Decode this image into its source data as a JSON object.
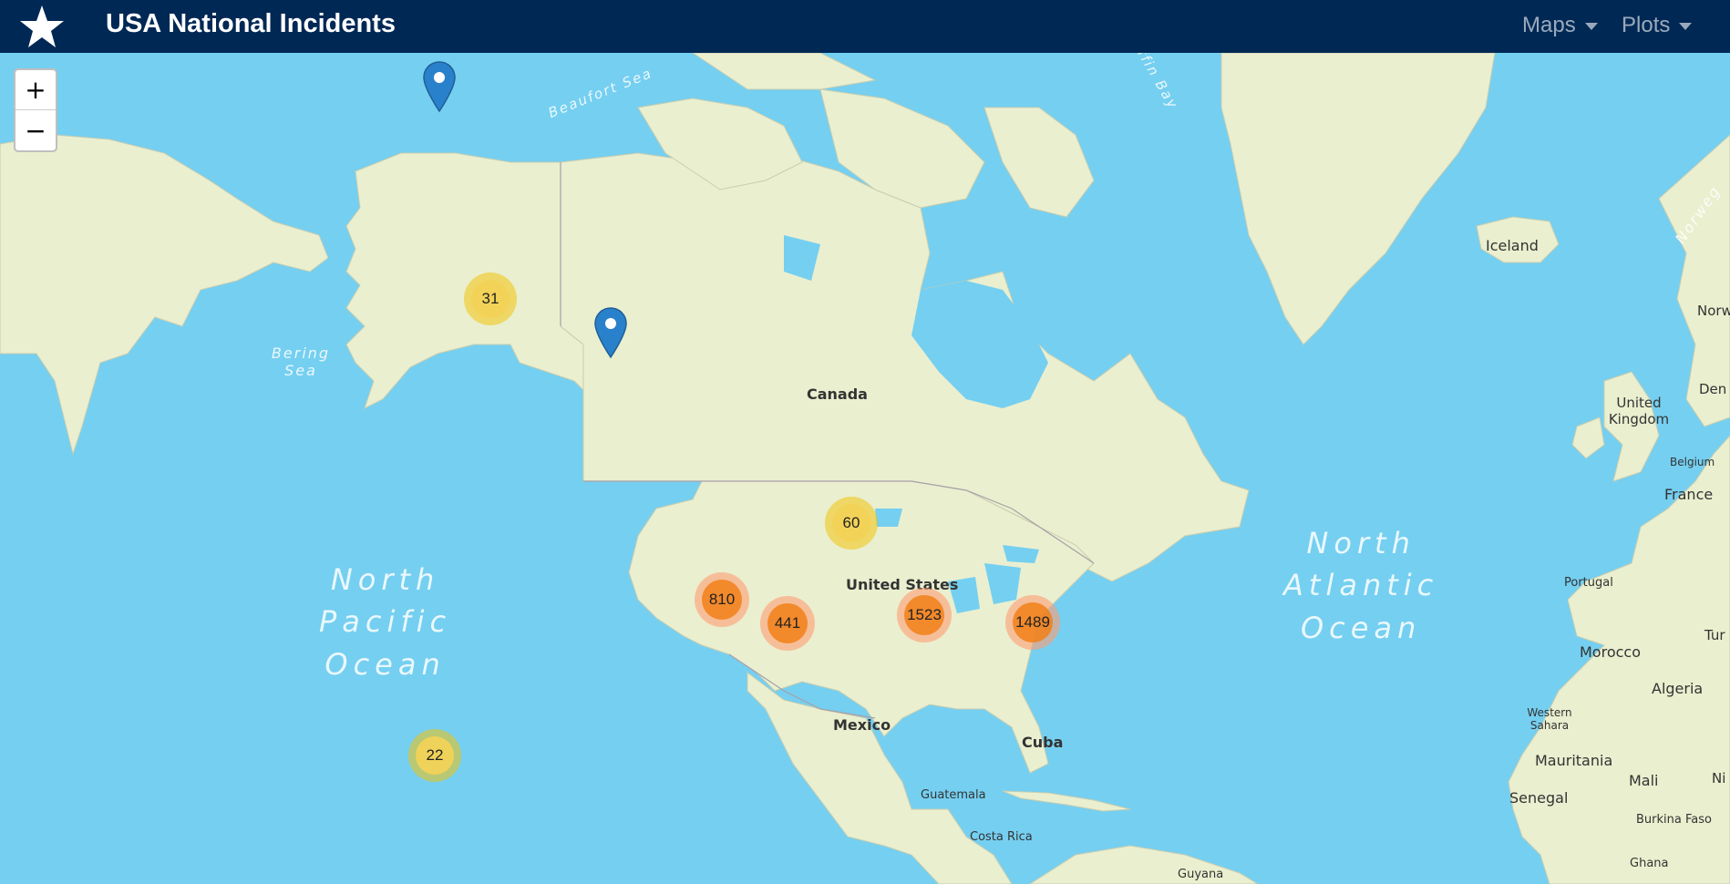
{
  "navbar": {
    "title": "USA National Incidents",
    "logo_icon": "star-icon",
    "menus": [
      {
        "label": "Maps"
      },
      {
        "label": "Plots"
      }
    ]
  },
  "zoom": {
    "in_label": "+",
    "out_label": "−"
  },
  "clusters": [
    {
      "count": "31",
      "level": "yellow"
    },
    {
      "count": "60",
      "level": "yellow"
    },
    {
      "count": "22",
      "level": "yellow"
    },
    {
      "count": "810",
      "level": "orange"
    },
    {
      "count": "441",
      "level": "orange"
    },
    {
      "count": "1523",
      "level": "orange"
    },
    {
      "count": "1489",
      "level": "orange"
    }
  ],
  "markers": [
    {
      "icon": "map-pin-icon"
    },
    {
      "icon": "map-pin-icon"
    }
  ],
  "map_labels": {
    "countries": [
      "Canada",
      "United States",
      "Mexico",
      "Cuba",
      "Guatemala",
      "Costa Rica",
      "Guyana",
      "Iceland",
      "United Kingdom",
      "France",
      "Belgium",
      "Portugal",
      "Morocco",
      "Algeria",
      "Western Sahara",
      "Mauritania",
      "Mali",
      "Senegal",
      "Burkina Faso",
      "Ghana",
      "Norw",
      "Den",
      "Tur",
      "Ni",
      "Norweg"
    ],
    "seas": [
      "Beaufort Sea",
      "Bering Sea",
      "Baffin Bay"
    ],
    "oceans": {
      "north_pacific": [
        "North",
        "Pacific",
        "Ocean"
      ],
      "north_atlantic": [
        "North",
        "Atlantic",
        "Ocean"
      ]
    }
  },
  "colors": {
    "navbar": "#002855",
    "water": "#75cff0",
    "land": "#eaefcf",
    "cluster_small": "#f1d357",
    "cluster_large": "#f18017",
    "marker": "#2a81cb"
  }
}
